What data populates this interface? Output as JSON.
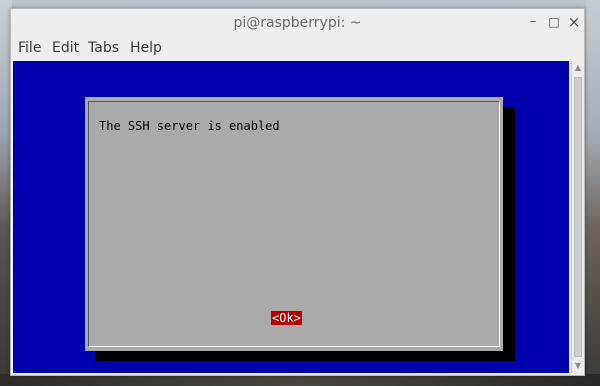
{
  "window": {
    "title": "pi@raspberrypi: ~",
    "controls": {
      "minimize": "–",
      "maximize": "□",
      "close": "×"
    }
  },
  "menubar": {
    "items": [
      "File",
      "Edit",
      "Tabs",
      "Help"
    ]
  },
  "dialog": {
    "message": "The SSH server is enabled",
    "ok_label": "<Ok>"
  },
  "scrollbar": {
    "up_icon": "▲",
    "down_icon": "▼"
  },
  "colors": {
    "terminal_background": "#0000ae",
    "dialog_background": "#aaaaaa",
    "ok_button_background": "#b90000"
  }
}
